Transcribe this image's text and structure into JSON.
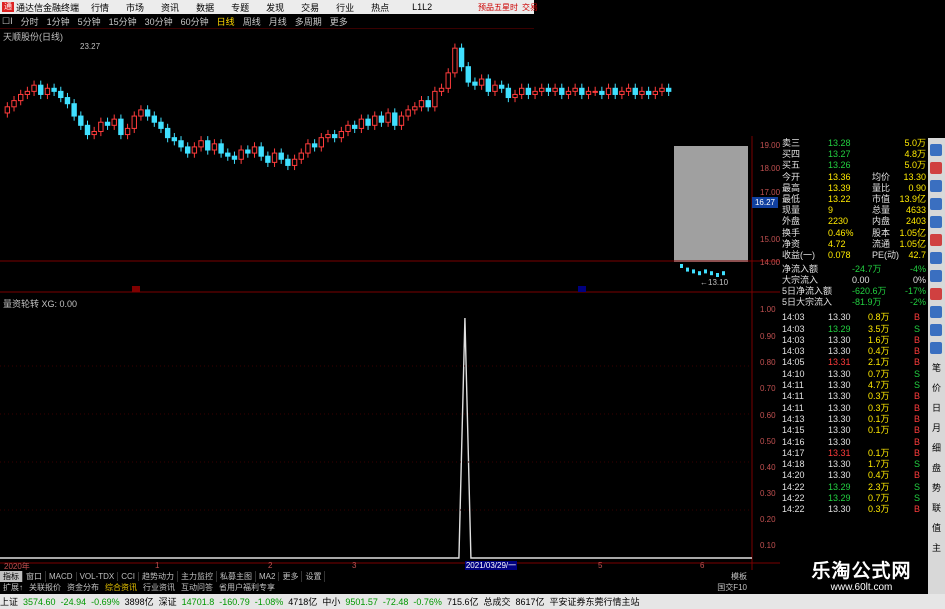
{
  "app": {
    "title": "通达信金融终端",
    "menu": [
      "行情",
      "市场",
      "资讯",
      "数据",
      "专题",
      "发现",
      "交易",
      "行业",
      "热点"
    ],
    "level": "L1L2",
    "window_tag": "交易",
    "corner_tag": "预品五星时"
  },
  "toolbar": {
    "items": [
      "分时",
      "1分钟",
      "5分钟",
      "15分钟",
      "30分钟",
      "60分钟",
      "日线",
      "周线",
      "月线",
      "多周期",
      "更多"
    ],
    "active": "日线",
    "prefix": "☐I"
  },
  "chart_header": {
    "stock": "天顺股份(日线)",
    "high_label": "23.27",
    "low_label": "←13.10",
    "indicator": "量资轮转 XG: 0.00",
    "selected_price": "16.27",
    "price_axis": [
      "19.00",
      "18.00",
      "17.00",
      "16.00",
      "15.00",
      "14.00"
    ],
    "ind_axis": [
      "1.00",
      "0.90",
      "0.80",
      "0.70",
      "0.60",
      "0.50",
      "0.40",
      "0.30",
      "0.20",
      "0.10"
    ],
    "x_ticks": [
      "2020年",
      "1",
      "2",
      "3",
      "5",
      "6"
    ],
    "date_cursor": "2021/03/29/一"
  },
  "quote": [
    {
      "l": "卖三",
      "v": "13.28",
      "l2": "",
      "v2": "5.0万"
    },
    {
      "l": "买四",
      "v": "13.27",
      "l2": "",
      "v2": "4.8万"
    },
    {
      "l": "买五",
      "v": "13.26",
      "l2": "",
      "v2": "5.0万"
    },
    {
      "l": "今开",
      "v": "13.36",
      "l2": "均价",
      "v2": "13.30"
    },
    {
      "l": "最高",
      "v": "13.39",
      "l2": "量比",
      "v2": "0.90"
    },
    {
      "l": "最低",
      "v": "13.22",
      "l2": "市值",
      "v2": "13.9亿"
    },
    {
      "l": "现量",
      "v": "9",
      "l2": "总量",
      "v2": "4633"
    },
    {
      "l": "外盘",
      "v": "2230",
      "l2": "内盘",
      "v2": "2403"
    },
    {
      "l": "换手",
      "v": "0.46%",
      "l2": "股本",
      "v2": "1.05亿"
    },
    {
      "l": "净资",
      "v": "4.72",
      "l2": "流通",
      "v2": "1.05亿"
    },
    {
      "l": "收益(一)",
      "v": "0.078",
      "l2": "PE(动)",
      "v2": "42.7"
    }
  ],
  "flow": [
    {
      "l": "净流入额",
      "v": "-24.7万",
      "p": "-4%"
    },
    {
      "l": "大宗流入",
      "v": "0.00",
      "p": "0%"
    },
    {
      "l": "5日净流入额",
      "v": "-620.6万",
      "p": "-17%"
    },
    {
      "l": "5日大宗流入",
      "v": "-81.9万",
      "p": "-2%"
    }
  ],
  "ticks": [
    {
      "t": "14:03",
      "p": "13.30",
      "v": "0.8万",
      "s": "B"
    },
    {
      "t": "14:03",
      "p": "13.29",
      "v": "3.5万",
      "s": "S"
    },
    {
      "t": "14:03",
      "p": "13.30",
      "v": "1.6万",
      "s": "B"
    },
    {
      "t": "14:03",
      "p": "13.30",
      "v": "0.4万",
      "s": "B"
    },
    {
      "t": "14:05",
      "p": "13.31",
      "v": "2.1万",
      "s": "B"
    },
    {
      "t": "14:10",
      "p": "13.30",
      "v": "0.7万",
      "s": "S"
    },
    {
      "t": "14:11",
      "p": "13.30",
      "v": "4.7万",
      "s": "S"
    },
    {
      "t": "14:11",
      "p": "13.30",
      "v": "0.3万",
      "s": "B"
    },
    {
      "t": "14:11",
      "p": "13.30",
      "v": "0.3万",
      "s": "B"
    },
    {
      "t": "14:13",
      "p": "13.30",
      "v": "0.1万",
      "s": "B"
    },
    {
      "t": "14:15",
      "p": "13.30",
      "v": "0.1万",
      "s": "B"
    },
    {
      "t": "14:16",
      "p": "13.30",
      "v": "",
      "s": "B"
    },
    {
      "t": "14:17",
      "p": "13.31",
      "v": "0.1万",
      "s": "B"
    },
    {
      "t": "14:18",
      "p": "13.30",
      "v": "1.7万",
      "s": "S"
    },
    {
      "t": "14:20",
      "p": "13.30",
      "v": "0.4万",
      "s": "B"
    },
    {
      "t": "14:22",
      "p": "13.29",
      "v": "2.3万",
      "s": "S"
    },
    {
      "t": "14:22",
      "p": "13.29",
      "v": "0.7万",
      "s": "S"
    },
    {
      "t": "14:22",
      "p": "13.30",
      "v": "0.3万",
      "s": "B"
    }
  ],
  "side_tabs": [
    "笔",
    "价",
    "日",
    "月",
    "细",
    "盘",
    "势",
    "联",
    "值",
    "主"
  ],
  "tabs1": [
    "指标",
    "窗口",
    "MACD",
    "VOL-TDX",
    "CCI",
    "趋势动力",
    "主力监控",
    "私募主图",
    "MA2",
    "更多",
    "设置"
  ],
  "tabs1_active": "指标",
  "tabs1_right": "模板",
  "tabs2": [
    "扩展↑",
    "关联报价",
    "资金分布",
    "综合资讯",
    "行业资讯",
    "互动问答",
    "省用户福利专享"
  ],
  "tabs2_right": "国交F10",
  "status": [
    {
      "t": "上证",
      "c": ""
    },
    {
      "t": "3574.60",
      "c": "g"
    },
    {
      "t": "-24.94",
      "c": "g"
    },
    {
      "t": "-0.69%",
      "c": "g"
    },
    {
      "t": "3898亿",
      "c": ""
    },
    {
      "t": "深证",
      "c": ""
    },
    {
      "t": "14701.8",
      "c": "g"
    },
    {
      "t": "-160.79",
      "c": "g"
    },
    {
      "t": "-1.08%",
      "c": "g"
    },
    {
      "t": "4718亿",
      "c": ""
    },
    {
      "t": "中小",
      "c": ""
    },
    {
      "t": "9501.57",
      "c": "g"
    },
    {
      "t": "-72.48",
      "c": "g"
    },
    {
      "t": "-0.76%",
      "c": "g"
    },
    {
      "t": "715.6亿",
      "c": ""
    },
    {
      "t": "总成交",
      "c": ""
    },
    {
      "t": "8617亿",
      "c": ""
    },
    {
      "t": "平安证券东莞行情主站",
      "c": ""
    }
  ],
  "watermark": {
    "big": "乐淘公式网",
    "small": "www.60lt.com"
  },
  "chart_data": {
    "type": "candlestick",
    "title": "天顺股份(日线)",
    "close": [
      17.9,
      18.1,
      18.3,
      18.4,
      18.6,
      18.3,
      18.5,
      18.4,
      18.2,
      18.0,
      17.6,
      17.3,
      17.0,
      17.1,
      17.4,
      17.3,
      17.5,
      17.0,
      17.2,
      17.6,
      17.8,
      17.6,
      17.4,
      17.2,
      16.9,
      16.8,
      16.6,
      16.4,
      16.6,
      16.8,
      16.5,
      16.7,
      16.4,
      16.3,
      16.2,
      16.5,
      16.4,
      16.6,
      16.3,
      16.1,
      16.4,
      16.2,
      16.0,
      16.2,
      16.4,
      16.7,
      16.6,
      16.9,
      17.0,
      16.9,
      17.1,
      17.3,
      17.2,
      17.5,
      17.3,
      17.6,
      17.4,
      17.7,
      17.3,
      17.6,
      17.8,
      17.9,
      18.1,
      17.9,
      18.4,
      18.5,
      19.0,
      19.8,
      19.2,
      18.7,
      18.6,
      18.8,
      18.4,
      18.6,
      18.5,
      18.2,
      18.3,
      18.5,
      18.3,
      18.4,
      18.5,
      18.4,
      18.5,
      18.3,
      18.4,
      18.5,
      18.3,
      18.4,
      18.4,
      18.3,
      18.5,
      18.3,
      18.4,
      18.5,
      18.3,
      18.4,
      18.3,
      18.4,
      18.5,
      18.4
    ],
    "tail": [
      13.6,
      13.4,
      13.3,
      13.2,
      13.3,
      13.2,
      13.1,
      13.2
    ],
    "indicator": {
      "name": "XG",
      "spike_index": 69,
      "value": 1.0,
      "ylim": [
        0,
        1
      ]
    },
    "ylim": [
      13.0,
      20.0
    ]
  }
}
